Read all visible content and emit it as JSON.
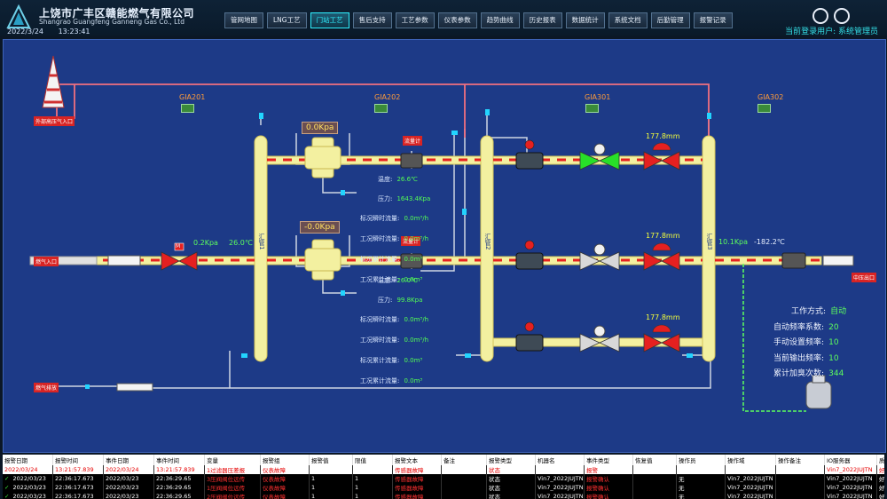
{
  "header": {
    "company": "上饶市广丰区赣能燃气有限公司",
    "company_en": "Shangrao Guangfeng Ganneng Gas Co., Ltd",
    "date": "2022/3/24",
    "time": "13:23:41",
    "user_label": "当前登录用户: 系统管理员",
    "nav": [
      "管网地图",
      "LNG工艺",
      "门站工艺",
      "售后支持",
      "工艺参数",
      "仪表参数",
      "趋势曲线",
      "历史报表",
      "数据统计",
      "系统文档",
      "后勤管理",
      "报警记录"
    ],
    "active_nav_index": 2
  },
  "diagram": {
    "inlet_label": "外部高压气入口",
    "gas_inlet_label": "燃气入口",
    "outlet_label": "中压出口",
    "bypass_label": "燃气排放",
    "gia": [
      "GIA201",
      "GIA202",
      "GIA301",
      "GIA302"
    ],
    "filter1_pressure": "0.0Kpa",
    "filter2_pressure": "-0.0Kpa",
    "meter_tag": "流量计",
    "header_pipe_1": "汇管1",
    "header_pipe_2": "汇管2",
    "header_pipe_3": "汇管3",
    "inlet_pressure": "0.2Kpa",
    "inlet_temp": "26.0℃",
    "outlet_pressure": "10.1Kpa",
    "outlet_temp": "-182.2℃",
    "valve_m": "M",
    "reg_openings": [
      "177.8mm",
      "177.8mm",
      "177.8mm"
    ],
    "meter1": {
      "temp_label": "温度:",
      "temp": "26.6℃",
      "press_label": "压力:",
      "press": "1643.4Kpa",
      "std_flow_label": "标况瞬时流量:",
      "std_flow": "0.0m³/h",
      "work_flow_label": "工况瞬时流量:",
      "work_flow": "0.0m³/h",
      "std_total_label": "标况累计流量:",
      "std_total": "0.0m³",
      "work_total_label": "工况累计流量:",
      "work_total": "0.0m³"
    },
    "meter2": {
      "temp_label": "温度:",
      "temp": "26.0℃",
      "press_label": "压力:",
      "press": "99.8Kpa",
      "std_flow_label": "标况瞬时流量:",
      "std_flow": "0.0m³/h",
      "work_flow_label": "工况瞬时流量:",
      "work_flow": "0.0m³/h",
      "std_total_label": "标况累计流量:",
      "std_total": "0.0m³",
      "work_total_label": "工况累计流量:",
      "work_total": "0.0m³"
    },
    "odorizer": {
      "mode_label": "工作方式:",
      "mode": "自动",
      "auto_freq_label": "自动频率系数:",
      "auto_freq": "20",
      "manual_freq_label": "手动设置频率:",
      "manual_freq": "10",
      "output_freq_label": "当前输出频率:",
      "output_freq": "10",
      "total_count_label": "累计加臭次数:",
      "total_count": "344"
    }
  },
  "alarm": {
    "columns": [
      "报警日期",
      "报警时间",
      "事件日期",
      "事件时间",
      "变量",
      "报警组",
      "报警值",
      "限值",
      "报警文本",
      "备注",
      "报警类型",
      "机器名",
      "事件类型",
      "恢复值",
      "操作员",
      "操作域",
      "操作备注",
      "IO服务器",
      "质量戳"
    ],
    "rows": [
      {
        "style": "red",
        "check": "",
        "cells": [
          "2022/03/24",
          "13:21:57.839",
          "2022/03/24",
          "13:21:57.839",
          "1过滤器压差报",
          "仪表故障",
          "",
          "",
          "传感器故障",
          "",
          "状态",
          "",
          "报警",
          "",
          "",
          "",
          "",
          "Vin7_2022JUJTN",
          "好"
        ]
      },
      {
        "style": "black",
        "check": "✓",
        "cells": [
          "2022/03/23",
          "22:36:17.673",
          "2022/03/23",
          "22:36:29.65",
          "3压阀阀位远传",
          "仪表故障",
          "1",
          "1",
          "传感器故障",
          "",
          "状态",
          "Vin7_2022JUJTN",
          "报警确认",
          "",
          "无",
          "Vin7_2022JUJTN",
          "",
          "Vin7_2022JUJTN",
          "好"
        ]
      },
      {
        "style": "black",
        "check": "✓",
        "cells": [
          "2022/03/23",
          "22:36:17.673",
          "2022/03/23",
          "22:36:29.65",
          "1压阀阀位远传",
          "仪表故障",
          "1",
          "1",
          "传感器故障",
          "",
          "状态",
          "Vin7_2022JUJTN",
          "报警确认",
          "",
          "无",
          "Vin7_2022JUJTN",
          "",
          "Vin7_2022JUJTN",
          "好"
        ]
      },
      {
        "style": "black",
        "check": "✓",
        "cells": [
          "2022/03/23",
          "22:36:17.673",
          "2022/03/23",
          "22:36:29.65",
          "2压阀阀位远传",
          "仪表故障",
          "1",
          "1",
          "传感器故障",
          "",
          "状态",
          "Vin7_2022JUJTN",
          "报警确认",
          "",
          "无",
          "Vin7_2022JUJTN",
          "",
          "Vin7_2022JUJTN",
          "好"
        ]
      }
    ]
  }
}
